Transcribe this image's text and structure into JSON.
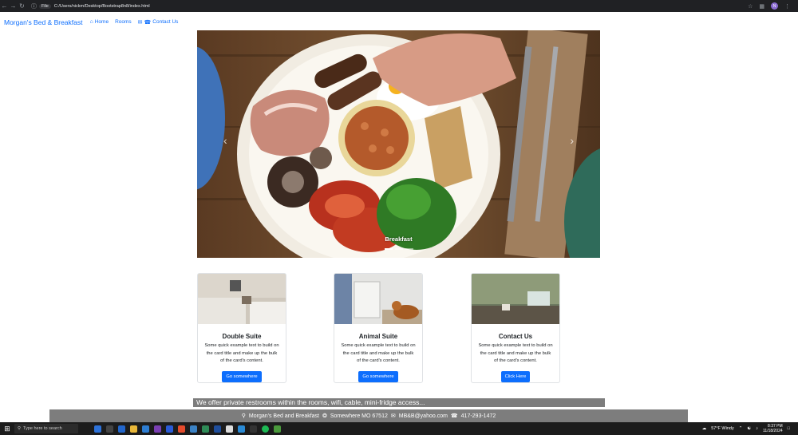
{
  "browser": {
    "back_icon": "back-arrow-icon",
    "forward_icon": "forward-arrow-icon",
    "reload_icon": "reload-icon",
    "file_chip": "File",
    "url": "C:/Users/nickm/Desktop/Bootstrap8n8/index.html",
    "profile_initial": "N"
  },
  "navbar": {
    "brand": "Morgan's Bed & Breakfast",
    "links": [
      {
        "label": "Home",
        "icon": "home-icon"
      },
      {
        "label": "Rooms",
        "icon": ""
      },
      {
        "label": "Contact Us",
        "icon": "envelope-phone-icon"
      }
    ]
  },
  "carousel": {
    "caption": "Breakfast",
    "slide_count": 3,
    "active_slide": 1
  },
  "cards": [
    {
      "title": "Double Suite",
      "text": "Some quick example text to build on the card title and make up the bulk of the card's content.",
      "button": "Go somewhere"
    },
    {
      "title": "Animal Suite",
      "text": "Some quick example text to build on the card title and make up the bulk of the card's content.",
      "button": "Go somewhere"
    },
    {
      "title": "Contact Us",
      "text": "Some quick example text to build on the card title and make up the bulk of the card's content.",
      "button": "Click Here"
    }
  ],
  "banner": "We offer private restrooms within the rooms, wifi, cable, mini-fridge access...",
  "footer": {
    "address": "Morgan's Bed and Breakfast",
    "location": "Somewhere MO 67512",
    "email": "MB&B@yahoo.com",
    "phone": "417-293-1472"
  },
  "taskbar": {
    "search_placeholder": "Type here to search",
    "weather": "57°F  Windy",
    "time": "8:37 PM",
    "date": "11/18/2024"
  },
  "colors": {
    "accent": "#0d6efd",
    "banner_bg": "#7d7d7d",
    "taskbar_bg": "#1c1c1c"
  }
}
